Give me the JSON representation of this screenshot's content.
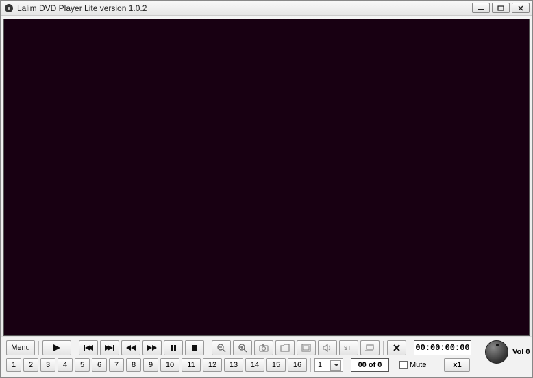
{
  "window": {
    "title": "Lalim DVD Player Lite version 1.0.2"
  },
  "toolbar": {
    "menu_label": "Menu",
    "time": "00:00:00:00"
  },
  "chapters": {
    "buttons": [
      "1",
      "2",
      "3",
      "4",
      "5",
      "6",
      "7",
      "8",
      "9",
      "10",
      "11",
      "12",
      "13",
      "14",
      "15",
      "16"
    ],
    "select_value": "1",
    "counter": "00 of 0"
  },
  "audio": {
    "vol_label": "Vol 0",
    "mute_label": "Mute",
    "speed_label": "x1"
  }
}
